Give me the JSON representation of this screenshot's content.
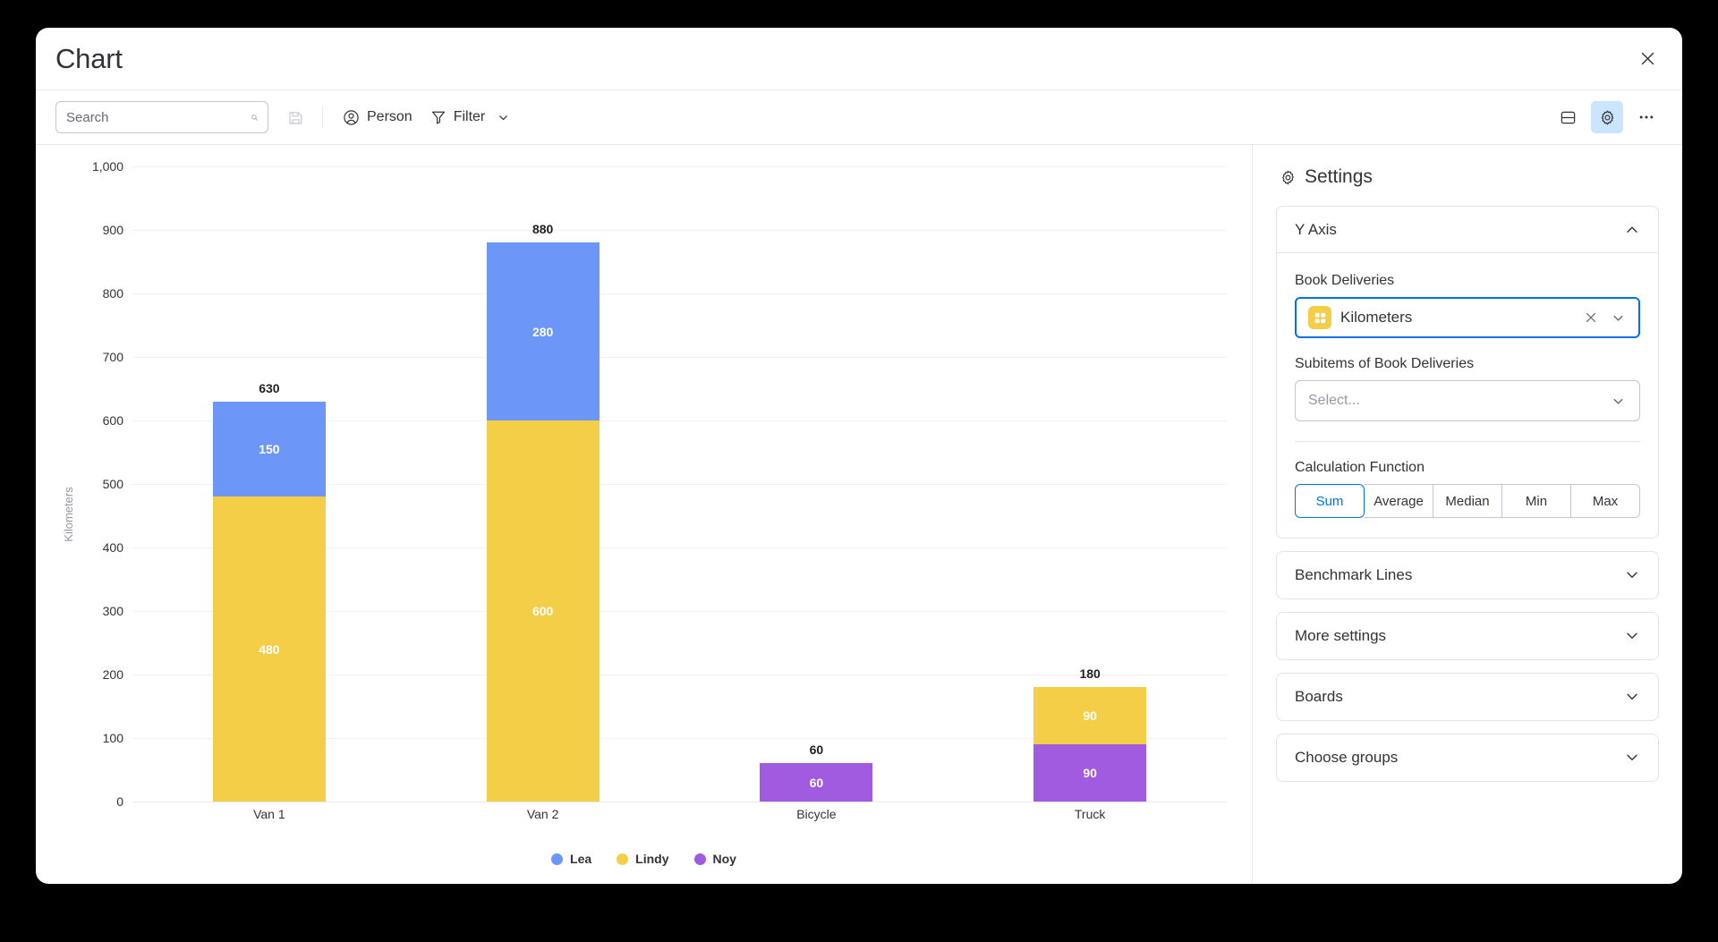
{
  "window": {
    "title": "Chart",
    "close_label": "×"
  },
  "toolbar": {
    "search_placeholder": "Search",
    "search_value": "",
    "search_icon": "search-icon",
    "save_icon": "save-disk-icon",
    "person_label": "Person",
    "person_icon": "person-circle-icon",
    "filter_label": "Filter",
    "filter_icon": "funnel-icon",
    "filter_caret_icon": "chevron-down-icon",
    "layout_icon": "split-layout-icon",
    "settings_icon": "gear-icon",
    "more_icon": "ellipsis-icon"
  },
  "settings": {
    "header": "Settings",
    "header_icon": "gear-icon",
    "sections": [
      {
        "id": "y-axis",
        "label": "Y Axis",
        "open": true,
        "caret": "chevron-up-icon"
      },
      {
        "id": "benchmark-lines",
        "label": "Benchmark Lines",
        "open": false,
        "caret": "chevron-down-icon"
      },
      {
        "id": "more-settings",
        "label": "More settings",
        "open": false,
        "caret": "chevron-down-icon"
      },
      {
        "id": "boards",
        "label": "Boards",
        "open": false,
        "caret": "chevron-down-icon"
      },
      {
        "id": "choose-groups",
        "label": "Choose groups",
        "open": false,
        "caret": "chevron-down-icon"
      }
    ],
    "y_axis": {
      "book_deliveries_label": "Book Deliveries",
      "book_deliveries_value": "Kilometers",
      "book_deliveries_chip_color": "#F5CE47",
      "book_deliveries_chip_icon": "numbers-column-icon",
      "clear_icon": "close-x-icon",
      "caret_icon": "chevron-down-icon",
      "subitems_label": "Subitems of Book Deliveries",
      "subitems_placeholder": "Select...",
      "calculation_label": "Calculation Function",
      "calculation_options": [
        "Sum",
        "Average",
        "Median",
        "Min",
        "Max"
      ],
      "calculation_selected": "Sum"
    }
  },
  "chart_data": {
    "type": "bar",
    "stacked": true,
    "title": "",
    "xlabel": "",
    "ylabel": "Kilometers",
    "ylim": [
      0,
      1000
    ],
    "ytick_values": [
      0,
      100,
      200,
      300,
      400,
      500,
      600,
      700,
      800,
      900,
      1000
    ],
    "ytick_labels": [
      "0",
      "100",
      "200",
      "300",
      "400",
      "500",
      "600",
      "700",
      "800",
      "900",
      "1,000"
    ],
    "grid": true,
    "legend_position": "bottom",
    "categories": [
      "Van 1",
      "Van 2",
      "Bicycle",
      "Truck"
    ],
    "series": [
      {
        "name": "Noy",
        "color": "#A05BE0",
        "values": [
          0,
          0,
          60,
          90
        ]
      },
      {
        "name": "Lindy",
        "color": "#F5CE47",
        "values": [
          480,
          600,
          0,
          90
        ]
      },
      {
        "name": "Lea",
        "color": "#6C96F7",
        "values": [
          150,
          280,
          0,
          0
        ]
      }
    ],
    "legend": [
      {
        "name": "Lea",
        "color": "#6C96F7"
      },
      {
        "name": "Lindy",
        "color": "#F5CE47"
      },
      {
        "name": "Noy",
        "color": "#A05BE0"
      }
    ],
    "totals": [
      630,
      880,
      60,
      180
    ],
    "total_labels": [
      "630",
      "880",
      "60",
      "180"
    ],
    "segment_labels": [
      [
        {
          "series": "Lindy",
          "value": "480",
          "color": "#F5CE47"
        },
        {
          "series": "Lea",
          "value": "150",
          "color": "#6C96F7"
        }
      ],
      [
        {
          "series": "Lindy",
          "value": "600",
          "color": "#F5CE47"
        },
        {
          "series": "Lea",
          "value": "280",
          "color": "#6C96F7"
        }
      ],
      [
        {
          "series": "Noy",
          "value": "60",
          "color": "#A05BE0"
        }
      ],
      [
        {
          "series": "Noy",
          "value": "90",
          "color": "#A05BE0"
        },
        {
          "series": "Lindy",
          "value": "90",
          "color": "#F5CE47"
        }
      ]
    ]
  }
}
